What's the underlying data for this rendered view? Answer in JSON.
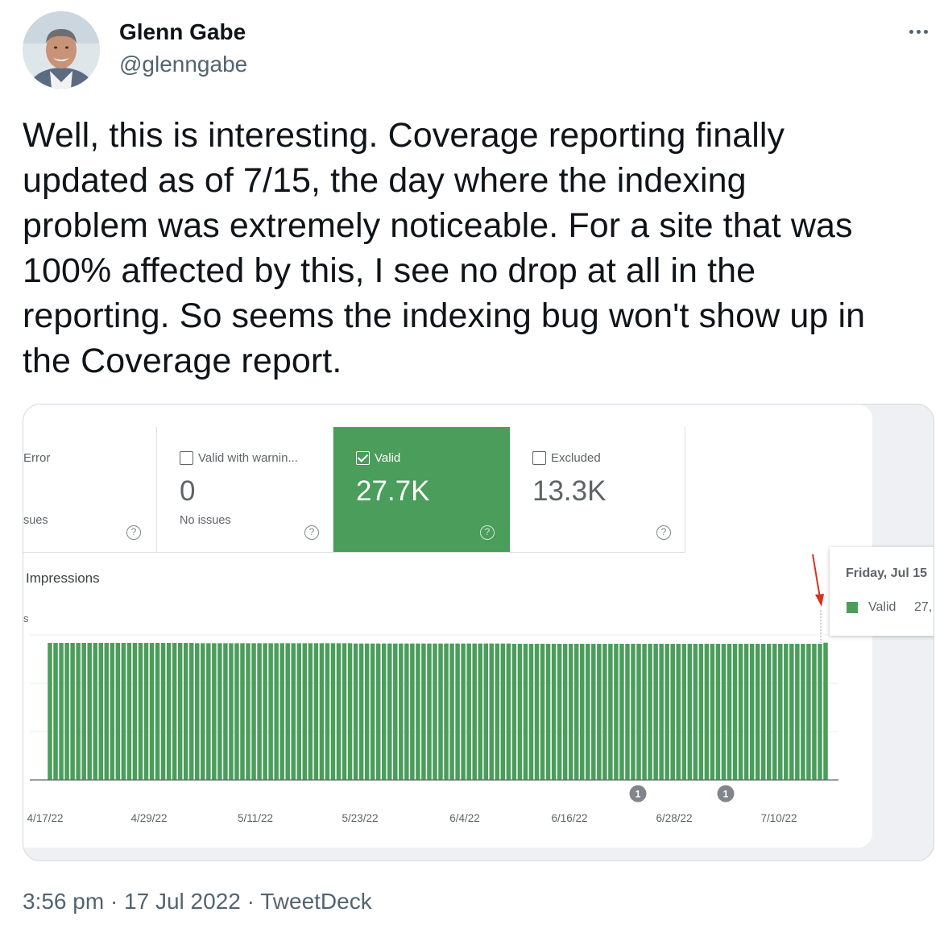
{
  "author": {
    "name": "Glenn Gabe",
    "handle": "@glenngabe"
  },
  "tweet": {
    "text": "Well, this is interesting. Coverage reporting finally\nupdated as of 7/15, the day where the indexing\nproblem was extremely noticeable. For a site that was\n100% affected by this, I see no drop at all in the\nreporting. So seems the indexing bug won't show up in\nthe Coverage report."
  },
  "screenshot": {
    "cards": [
      {
        "label": "Error",
        "value": "",
        "sub": "sues",
        "checked": false,
        "selected": false
      },
      {
        "label": "Valid with warnin...",
        "value": "0",
        "sub": "No issues",
        "checked": false,
        "selected": false
      },
      {
        "label": "Valid",
        "value": "27.7K",
        "sub": "",
        "checked": true,
        "selected": true
      },
      {
        "label": "Excluded",
        "value": "13.3K",
        "sub": "",
        "checked": false,
        "selected": false
      }
    ],
    "impressions_label": "Impressions",
    "axis_fragment": "s",
    "tooltip": {
      "date": "Friday, Jul 15",
      "series": "Valid",
      "value": "27,"
    },
    "colors": {
      "valid_green": "#4a9d5b",
      "annotation_arrow": "#d93025",
      "annotation_badge": "#80868b"
    }
  },
  "chart_data": {
    "type": "bar",
    "series": [
      {
        "name": "Valid",
        "values": [
          100,
          100,
          100,
          100,
          100,
          100,
          100,
          100,
          100,
          100,
          100,
          100,
          100,
          100,
          100,
          100,
          100,
          100,
          100,
          100,
          100,
          100,
          100,
          100,
          100,
          100,
          99.8,
          99.8,
          99.8,
          99.8,
          99.8,
          99.8,
          99.8,
          99.8,
          99.8,
          99.8,
          99.8,
          99.8,
          99.8,
          99.8,
          99.8,
          99.8,
          99.8,
          99.8,
          99.8,
          99.8,
          99.8,
          99.8,
          99.8,
          99.8,
          99.8,
          99.8,
          99.8,
          99.8,
          99.6,
          99.6,
          99.6,
          99.6,
          99.6,
          99.6,
          99.6,
          99.6,
          99.6,
          99.6,
          99.6,
          99.6,
          99.6,
          99.6,
          99.6,
          99.6,
          99.6,
          99.6,
          99.6,
          99.6,
          99.6,
          99.6,
          99.6,
          99.6,
          99.6,
          99.6,
          99.6,
          99.6,
          99.4,
          99.4,
          99.4,
          99.4,
          99.4,
          99.4,
          99.4,
          99.4,
          99.4,
          99.4,
          99.4,
          99.4,
          99.4,
          99.4,
          99.4,
          99.4,
          99.4,
          99.4,
          99.4,
          99.4,
          99.4,
          99.4,
          99.4,
          99.4,
          99.4,
          99.4,
          99.4,
          99.4,
          99.4,
          99.4,
          99.4,
          99.4,
          99.4,
          99.4,
          99.4,
          99.4,
          99.4,
          99.4,
          99.4,
          99.4,
          99.4,
          99.4,
          99.4,
          99.4,
          99.4,
          99.4,
          99.4,
          99.4,
          99.4,
          99.4,
          99.4,
          99.4,
          99.4,
          99.4,
          99.4,
          100.2
        ]
      }
    ],
    "x_tick_labels": [
      "4/17/22",
      "4/29/22",
      "5/11/22",
      "5/23/22",
      "6/4/22",
      "6/16/22",
      "6/28/22",
      "7/10/22"
    ],
    "annotations": [
      {
        "label": "1",
        "date": "6/24/22"
      },
      {
        "label": "1",
        "date": "7/2/22"
      }
    ],
    "highlight": {
      "date": "7/15/22",
      "note": "arrow"
    },
    "ylim": [
      0,
      100
    ],
    "grid": true,
    "legend": "none",
    "y_scale": "relative"
  }
}
